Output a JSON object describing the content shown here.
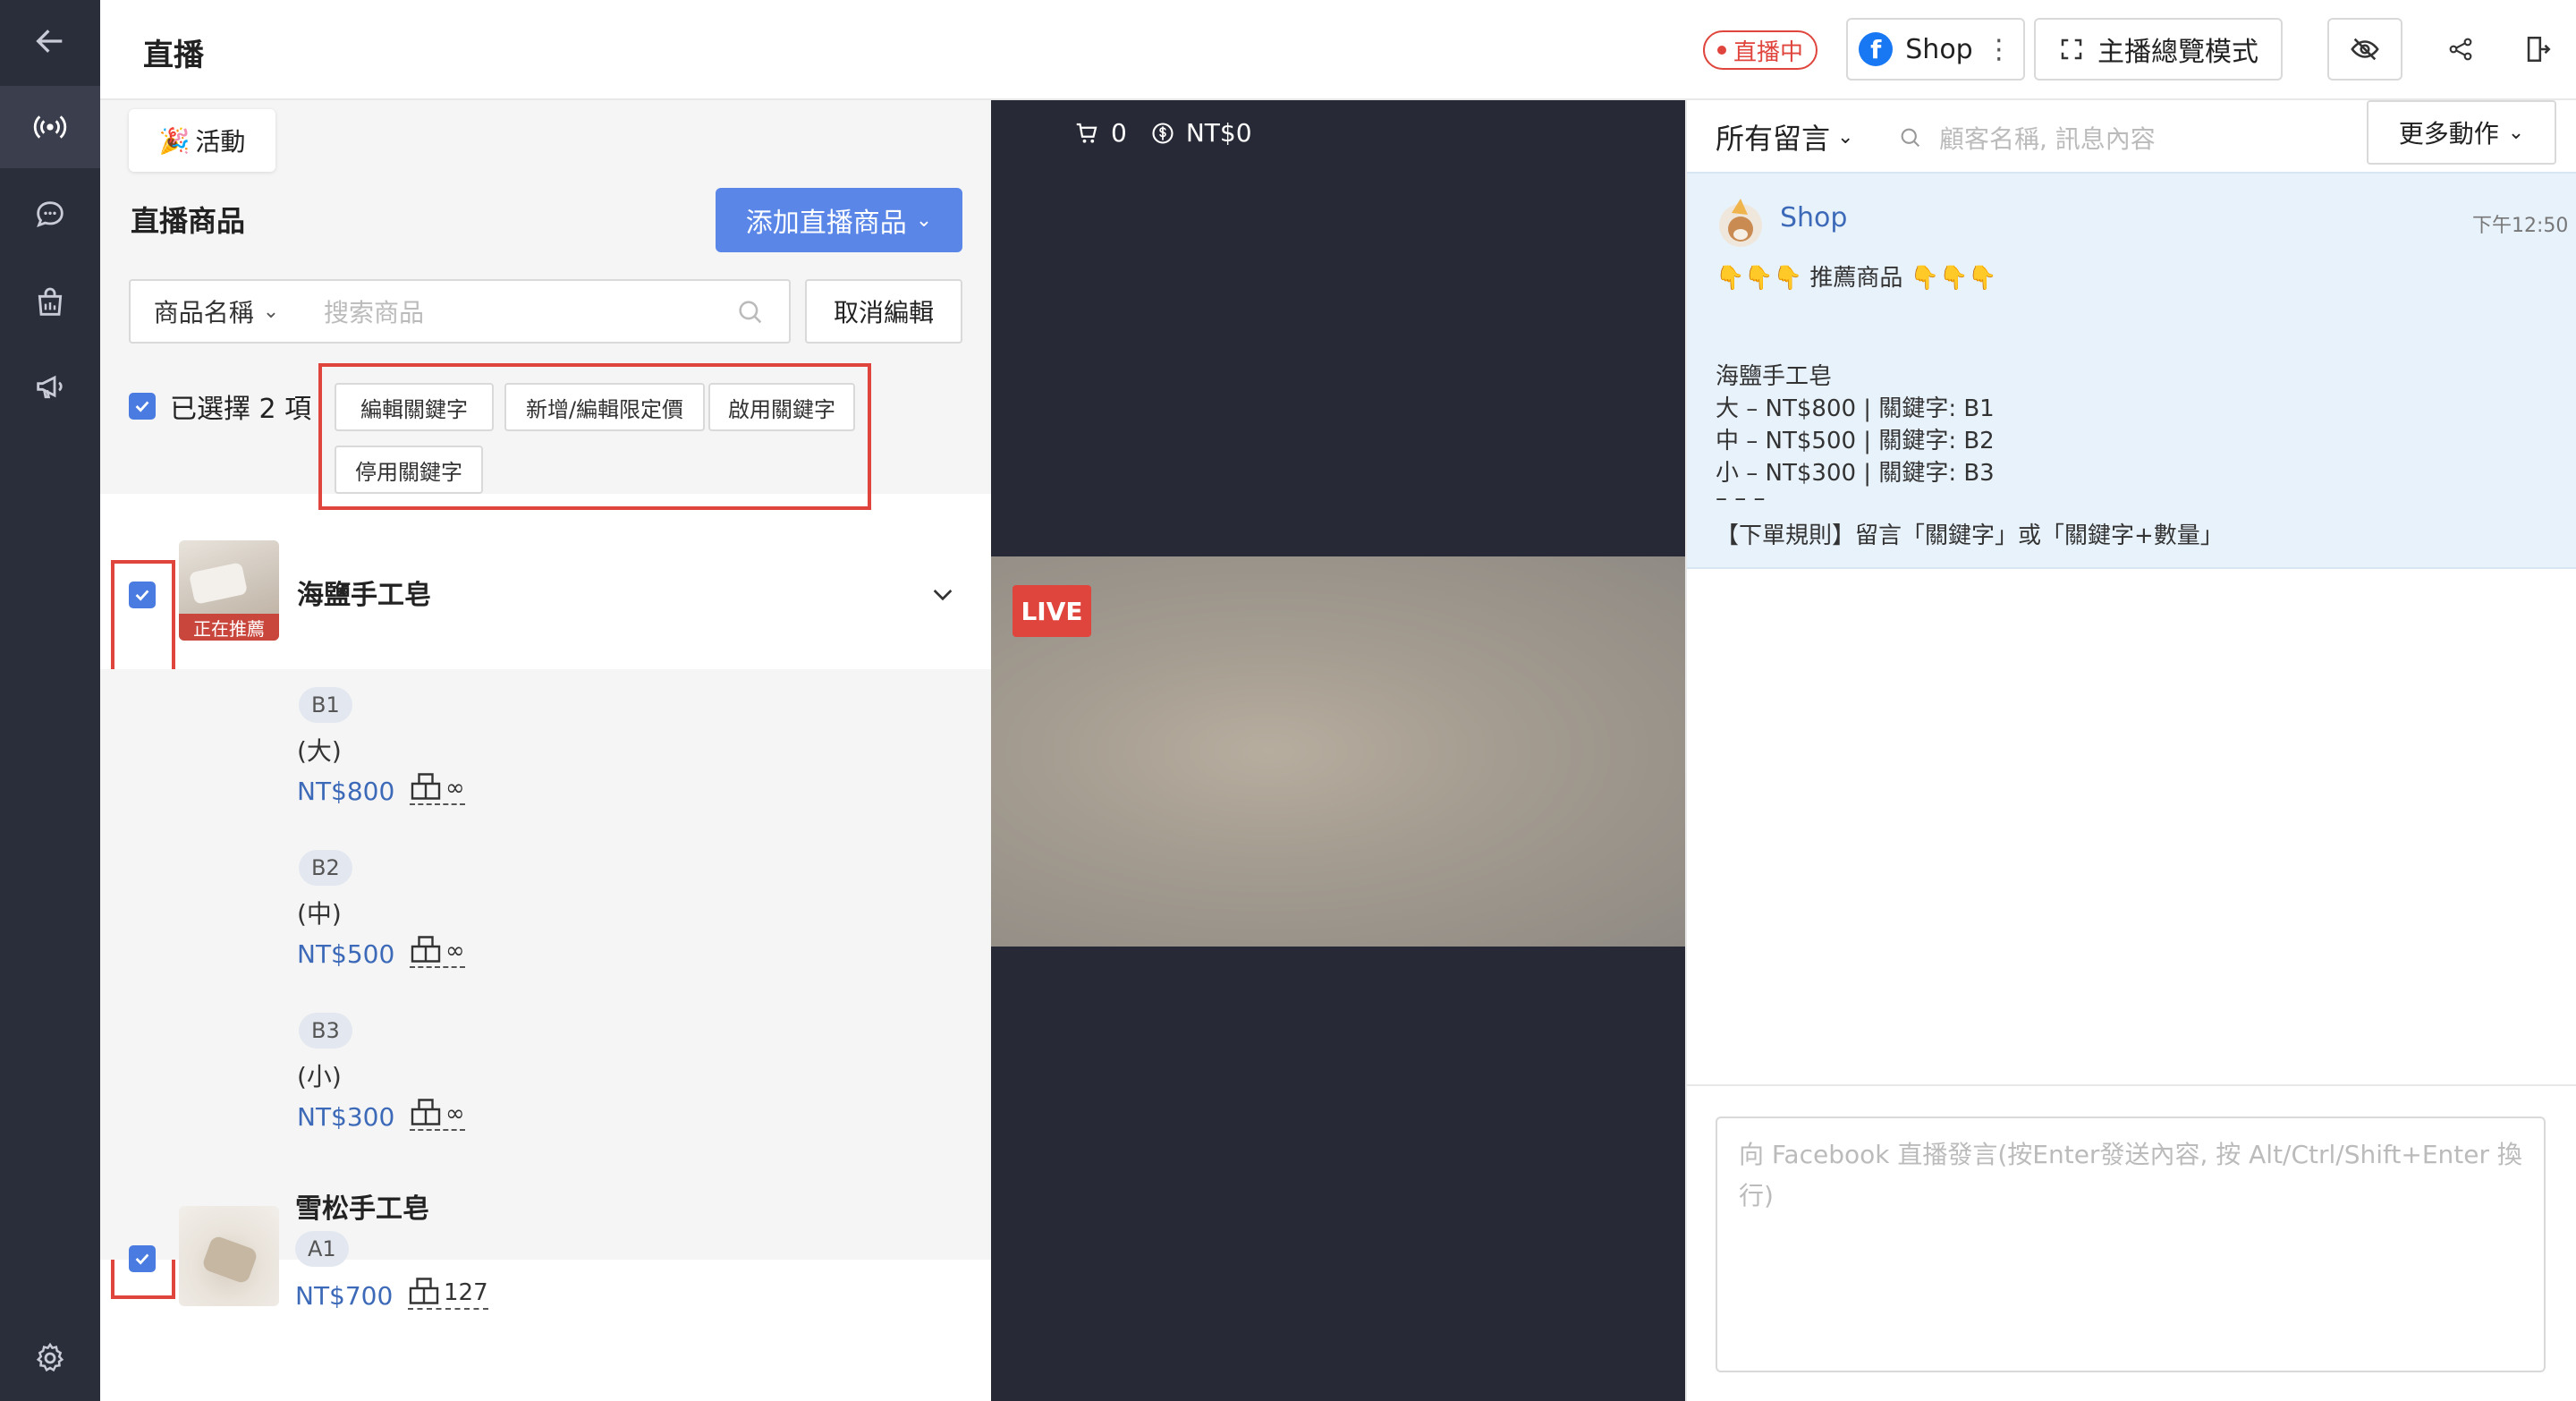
{
  "header": {
    "title": "直播",
    "live_status": "直播中",
    "account_name": "Shop",
    "overview_mode_label": "主播總覽模式"
  },
  "left_panel": {
    "activity_label": "活動",
    "section_title": "直播商品",
    "add_button_label": "添加直播商品",
    "filter_select_value": "商品名稱",
    "search_placeholder": "搜索商品",
    "cancel_edit_label": "取消編輯",
    "selected_count_label": "已選擇 2 項",
    "keyword_actions": [
      "編輯關鍵字",
      "新增/編輯限定價",
      "啟用關鍵字",
      "停用關鍵字"
    ],
    "products": [
      {
        "name": "海鹽手工皂",
        "badge": "正在推薦",
        "variants": [
          {
            "keyword": "B1",
            "size": "(大)",
            "price": "NT$800",
            "stock": "∞"
          },
          {
            "keyword": "B2",
            "size": "(中)",
            "price": "NT$500",
            "stock": "∞"
          },
          {
            "keyword": "B3",
            "size": "(小)",
            "price": "NT$300",
            "stock": "∞"
          }
        ]
      },
      {
        "name": "雪松手工皂",
        "keyword": "A1",
        "price": "NT$700",
        "stock": "127"
      }
    ]
  },
  "video": {
    "cart_count": "0",
    "revenue": "NT$0",
    "live_label": "LIVE"
  },
  "chat": {
    "filter_label": "所有留言",
    "search_placeholder": "顧客名稱, 訊息內容",
    "more_actions_label": "更多動作",
    "messages": [
      {
        "author": "Shop",
        "time": "下午12:50",
        "lines": [
          "👇👇👇 推薦商品 👇👇👇",
          "",
          "海鹽手工皂",
          "大 – NT$800 | 關鍵字: B1",
          "中 – NT$500 | 關鍵字: B2",
          "小 – NT$300 | 關鍵字: B3",
          "",
          "– – –",
          "【下單規則】留言「關鍵字」或「關鍵字+數量」"
        ]
      }
    ],
    "compose_placeholder": "向 Facebook 直播發言(按Enter發送內容, 按 Alt/Ctrl/Shift+Enter 換行)"
  },
  "colors": {
    "rail": "#2a2d3a",
    "accent": "#5a86e8",
    "live": "#e0453d",
    "price": "#3d6ab8"
  }
}
